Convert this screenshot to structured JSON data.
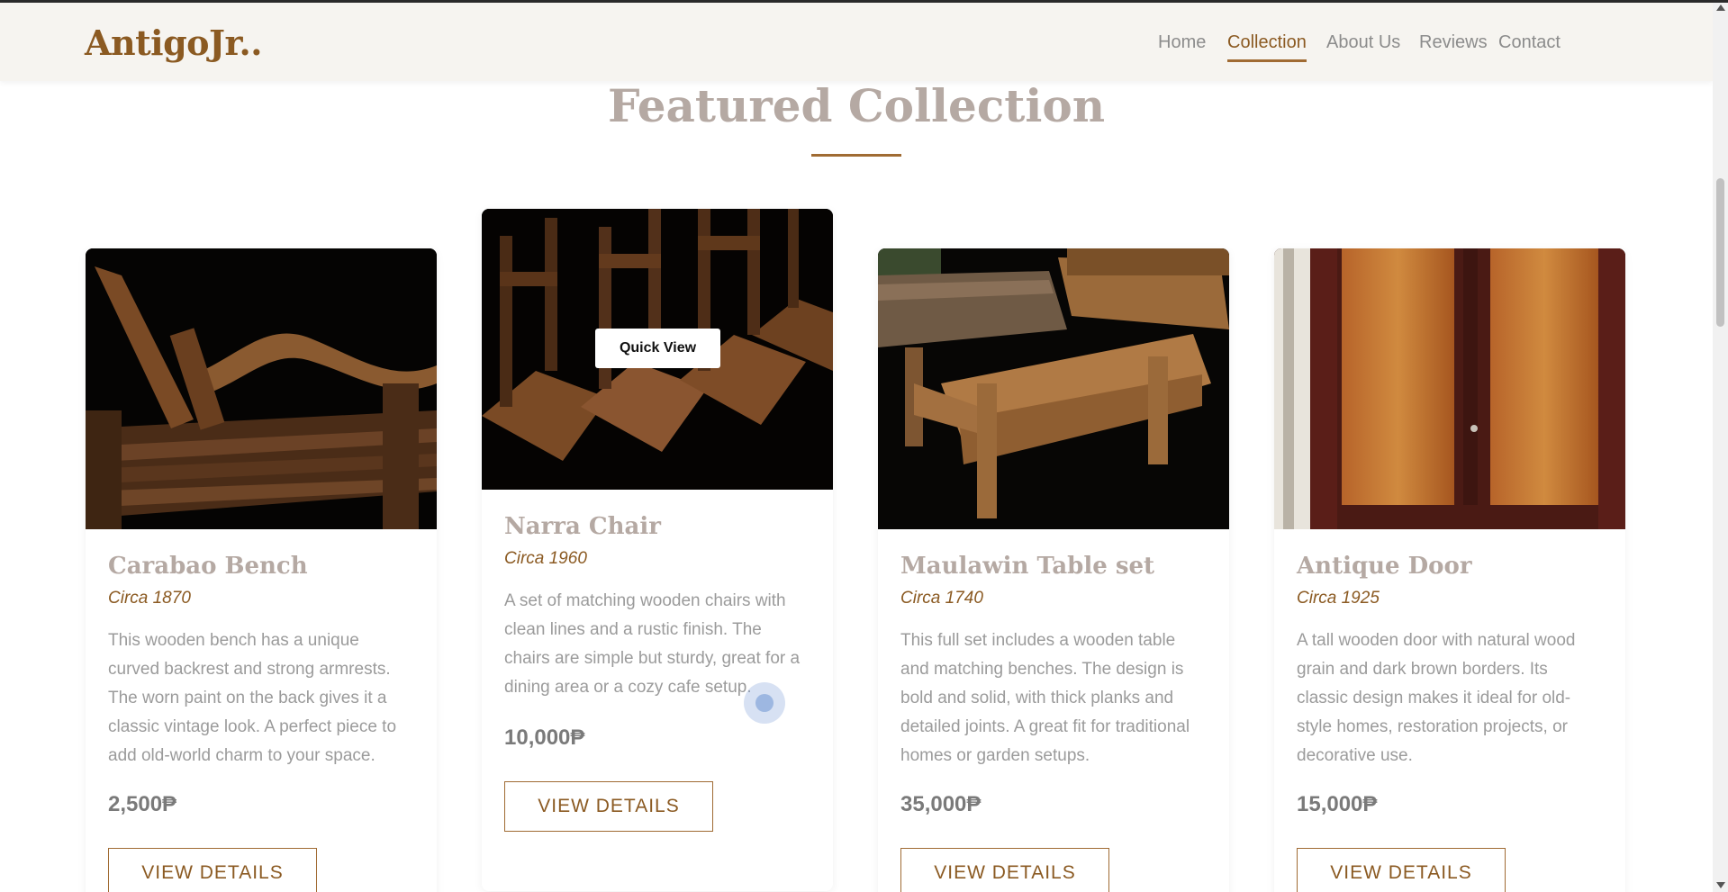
{
  "header": {
    "logo": "AntigoJr..",
    "nav": [
      {
        "label": "Home"
      },
      {
        "label": "Collection"
      },
      {
        "label": "About Us"
      },
      {
        "label": "Reviews"
      },
      {
        "label": "Contact"
      }
    ],
    "active_nav": "Collection"
  },
  "section": {
    "title": "Featured Collection"
  },
  "products": [
    {
      "name": "Carabao Bench",
      "circa": "Circa 1870",
      "description": "This wooden bench has a unique curved backrest and strong armrests. The worn paint on the back gives it a classic vintage look. A perfect piece to add old-world charm to your space.",
      "price": "2,500₱",
      "button": "VIEW DETAILS"
    },
    {
      "name": "Narra Chair",
      "circa": "Circa 1960",
      "description": "A set of matching wooden chairs with clean lines and a rustic finish. The chairs are simple but sturdy, great for a dining area or a cozy cafe setup.",
      "price": "10,000₱",
      "button": "VIEW DETAILS",
      "quick_view": "Quick View"
    },
    {
      "name": "Maulawin Table set",
      "circa": "Circa 1740",
      "description": "This full set includes a wooden table and matching benches. The design is bold and solid, with thick planks and detailed joints. A great fit for traditional homes or garden setups.",
      "price": "35,000₱",
      "button": "VIEW DETAILS"
    },
    {
      "name": "Antique Door",
      "circa": "Circa 1925",
      "description": "A tall wooden door with natural wood grain and dark brown borders. Its classic design makes it ideal for old-style homes, restoration projects, or decorative use.",
      "price": "15,000₱",
      "button": "VIEW DETAILS"
    }
  ],
  "colors": {
    "brand": "#8b5a22",
    "accent": "#a06b33",
    "title_gray": "#b5a9a3",
    "text_gray": "#9b9b9b",
    "header_bg": "#f6f4f0"
  }
}
